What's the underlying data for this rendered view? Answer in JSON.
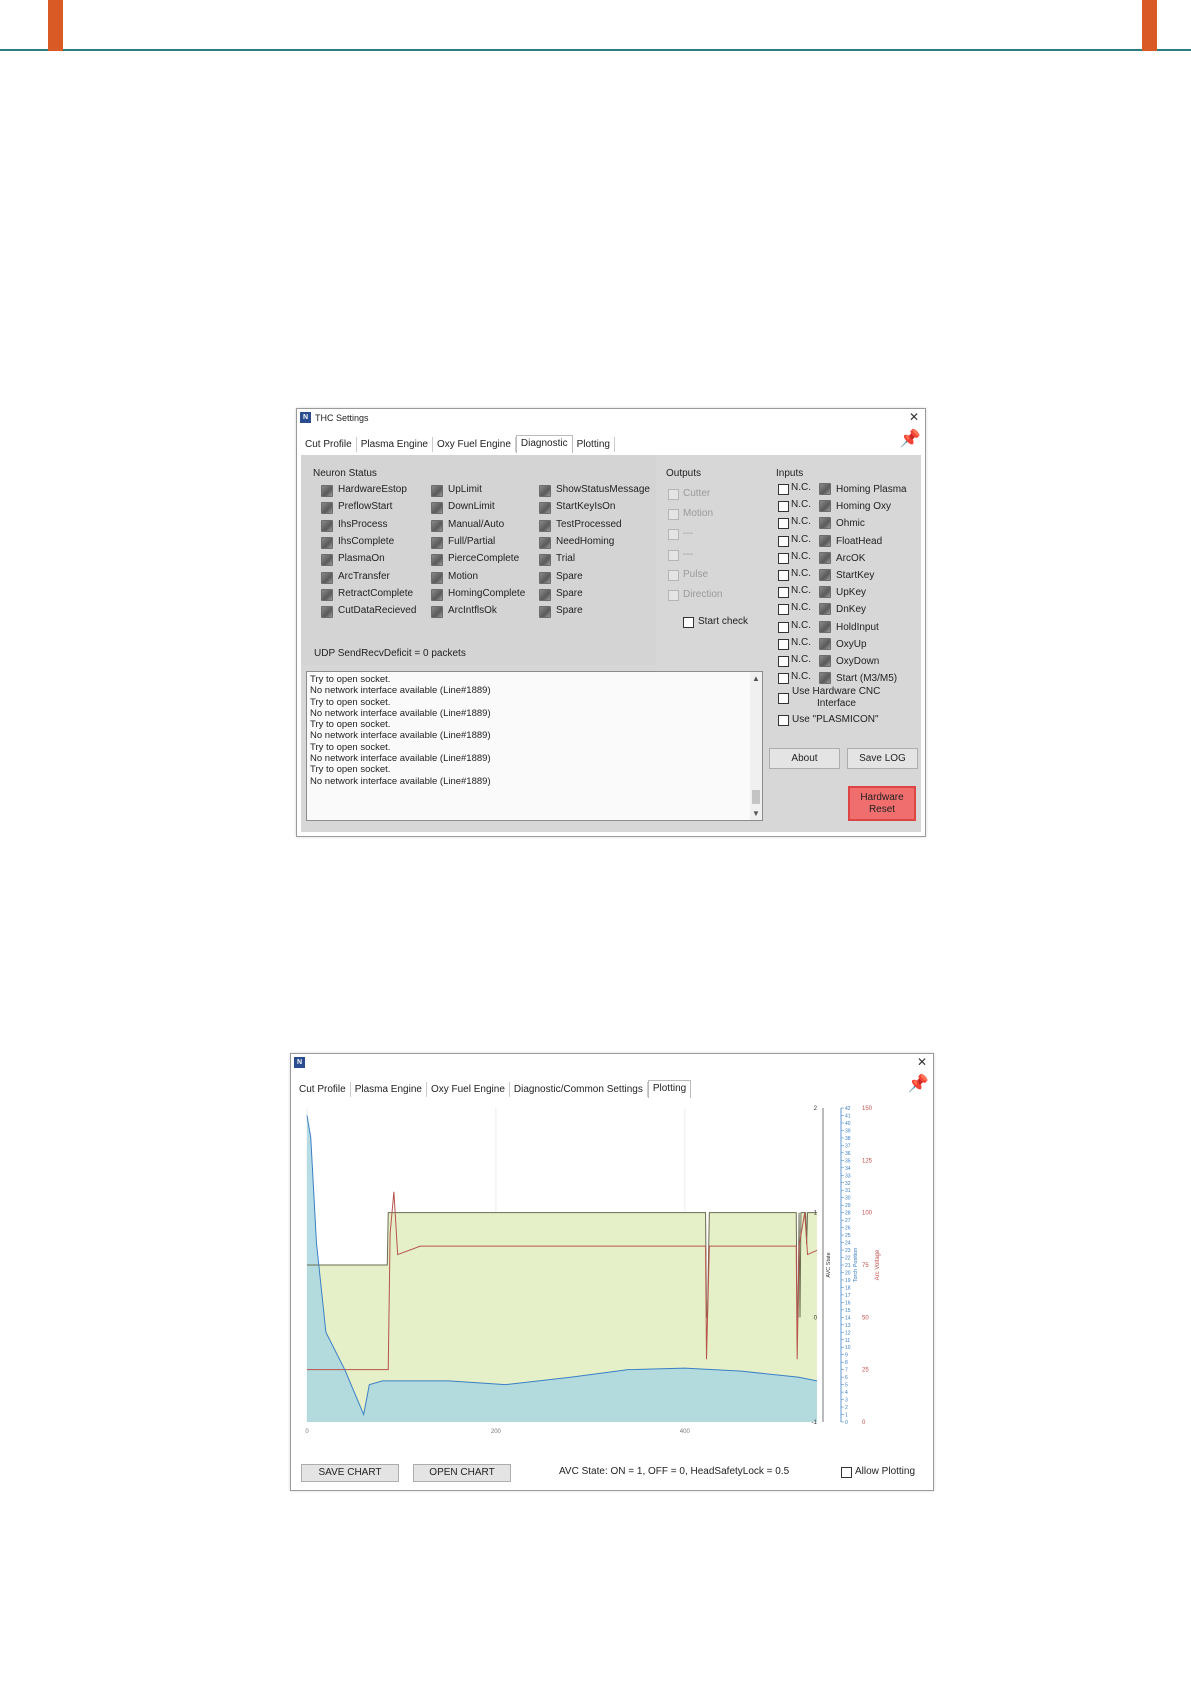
{
  "thc_window": {
    "title": "THC Settings",
    "tabs": [
      "Cut Profile",
      "Plasma Engine",
      "Oxy Fuel Engine",
      "Diagnostic",
      "Plotting"
    ],
    "active_tab": "Diagnostic",
    "neuron_status_label": "Neuron Status",
    "neuron_col1": [
      "HardwareEstop",
      "PreflowStart",
      "IhsProcess",
      "IhsComplete",
      "PlasmaOn",
      "ArcTransfer",
      "RetractComplete",
      "CutDataRecieved"
    ],
    "neuron_col2": [
      "UpLimit",
      "DownLimit",
      "Manual/Auto",
      "Full/Partial",
      "PierceComplete",
      "Motion",
      "HomingComplete",
      "ArcIntflsOk"
    ],
    "neuron_col3": [
      "ShowStatusMessage",
      "StartKeyIsOn",
      "TestProcessed",
      "NeedHoming",
      "Trial",
      "Spare",
      "Spare",
      "Spare"
    ],
    "udp_text": "UDP SendRecvDeficit = 0 packets",
    "outputs_label": "Outputs",
    "outputs": [
      "Cutter",
      "Motion",
      "---",
      "---",
      "Pulse",
      "Direction"
    ],
    "start_check": "Start check",
    "inputs_label": "Inputs",
    "nc_label": "N.C.",
    "inputs": [
      "Homing Plasma",
      "Homing Oxy",
      "Ohmic",
      "FloatHead",
      "ArcOK",
      "StartKey",
      "UpKey",
      "DnKey",
      "HoldInput",
      "OxyUp",
      "OxyDown",
      "Start (M3/M5)"
    ],
    "use_hw_cnc_line1": "Use Hardware CNC",
    "use_hw_cnc_line2": "Interface",
    "use_plasmicon": "Use \"PLASMICON\"",
    "about_btn": "About",
    "save_log_btn": "Save LOG",
    "hw_reset_line1": "Hardware",
    "hw_reset_line2": "Reset",
    "log": [
      "Try to open socket.",
      "No network interface available (Line#1889)",
      "Try to open socket.",
      "No network interface available (Line#1889)",
      "Try to open socket.",
      "No network interface available (Line#1889)",
      "Try to open socket.",
      "No network interface available (Line#1889)",
      "Try to open socket.",
      "No network interface available (Line#1889)"
    ]
  },
  "plot_window": {
    "tabs": [
      "Cut Profile",
      "Plasma Engine",
      "Oxy Fuel Engine",
      "Diagnostic/Common Settings",
      "Plotting"
    ],
    "active_tab": "Plotting",
    "save_chart": "SAVE CHART",
    "open_chart": "OPEN CHART",
    "avc_text": "AVC State: ON = 1, OFF = 0, HeadSafetyLock = 0.5",
    "allow_plotting": "Allow Plotting"
  },
  "chart_data": {
    "type": "line",
    "x_ticks": [
      "0",
      "200",
      "400"
    ],
    "xlim": [
      0,
      540
    ],
    "axes": [
      {
        "label": "AVC State",
        "ticks": [
          "2",
          "1",
          "0",
          "-1"
        ],
        "range": [
          -1,
          2
        ],
        "color": "#333333"
      },
      {
        "label": "Torch Position",
        "range": [
          0,
          42
        ],
        "color": "#3a7fc4"
      },
      {
        "label": "Arc Voltage",
        "ticks": [
          "150",
          "125",
          "100",
          "75",
          "50",
          "25",
          "0"
        ],
        "range": [
          0,
          150
        ],
        "color": "#c0504d"
      }
    ],
    "series": [
      {
        "axis": "AVC State",
        "color": "#6b6b4f",
        "fill": "#e6f0c8",
        "points": [
          [
            0,
            0.5
          ],
          [
            85,
            0.5
          ],
          [
            86,
            1
          ],
          [
            422,
            1
          ],
          [
            423,
            0
          ],
          [
            424,
            0
          ],
          [
            426,
            1
          ],
          [
            518,
            1
          ],
          [
            519,
            0
          ],
          [
            520,
            0
          ],
          [
            521,
            1
          ],
          [
            522,
            0
          ],
          [
            523,
            1
          ],
          [
            528,
            1
          ],
          [
            529,
            0.7
          ],
          [
            530,
            1
          ],
          [
            540,
            1
          ]
        ]
      },
      {
        "axis": "Arc Voltage",
        "color": "#b5544b",
        "points": [
          [
            0,
            25
          ],
          [
            86,
            25
          ],
          [
            88,
            90
          ],
          [
            92,
            110
          ],
          [
            96,
            80
          ],
          [
            120,
            84
          ],
          [
            200,
            84
          ],
          [
            280,
            84
          ],
          [
            360,
            84
          ],
          [
            422,
            84
          ],
          [
            423,
            30
          ],
          [
            426,
            84
          ],
          [
            518,
            84
          ],
          [
            519,
            30
          ],
          [
            521,
            84
          ],
          [
            527,
            100
          ],
          [
            530,
            80
          ],
          [
            540,
            82
          ]
        ]
      },
      {
        "axis": "Torch Position",
        "color": "#3a7fc4",
        "fill": "#a9d7e0",
        "points": [
          [
            0,
            41
          ],
          [
            4,
            38
          ],
          [
            10,
            24
          ],
          [
            20,
            12
          ],
          [
            40,
            7
          ],
          [
            60,
            1
          ],
          [
            66,
            5
          ],
          [
            80,
            5.5
          ],
          [
            150,
            5.5
          ],
          [
            210,
            5
          ],
          [
            280,
            6
          ],
          [
            340,
            7
          ],
          [
            400,
            7.2
          ],
          [
            460,
            6.8
          ],
          [
            520,
            6
          ],
          [
            540,
            5.5
          ]
        ]
      }
    ]
  }
}
